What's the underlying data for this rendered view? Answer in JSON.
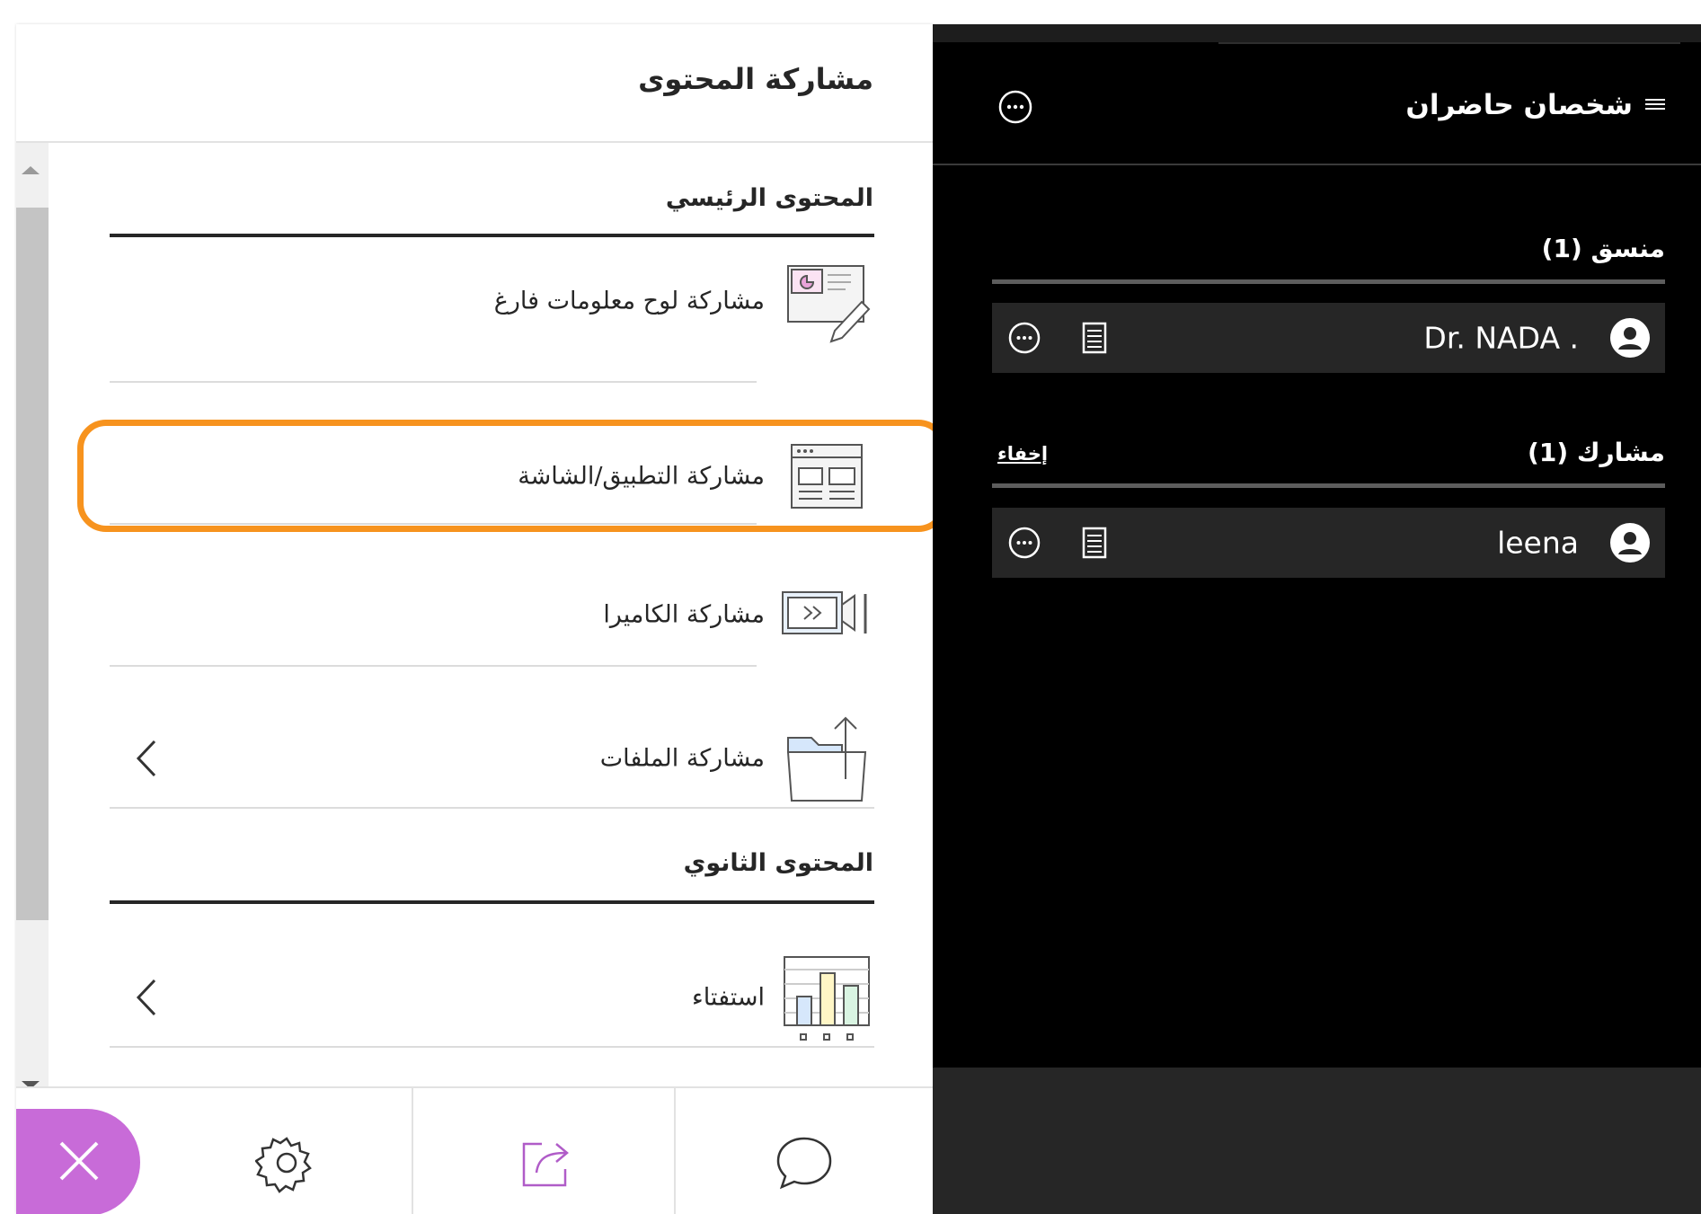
{
  "share_panel": {
    "title": "مشاركة المحتوى",
    "primary_heading": "المحتوى الرئيسي",
    "secondary_heading": "المحتوى الثانوي",
    "items": [
      {
        "label": "مشاركة لوح معلومات فارغ",
        "icon": "whiteboard-icon"
      },
      {
        "label": "مشاركة التطبيق/الشاشة",
        "icon": "screen-share-icon",
        "highlighted": true
      },
      {
        "label": "مشاركة الكاميرا",
        "icon": "camera-icon"
      },
      {
        "label": "مشاركة الملفات",
        "icon": "file-upload-icon",
        "has_submenu": true
      }
    ],
    "secondary_items": [
      {
        "label": "استفتاء",
        "icon": "poll-icon",
        "has_submenu": true
      }
    ]
  },
  "bottom_bar": {
    "buttons": [
      "close-icon",
      "gear-icon",
      "share-content-icon",
      "chat-icon"
    ],
    "accent_color": "#c86bd8"
  },
  "attendees": {
    "title": "شخصان حاضران",
    "groups": [
      {
        "heading": "منسق (1)",
        "people": [
          {
            "name": "Dr. NADA ."
          }
        ]
      },
      {
        "heading": "مشارك (1)",
        "action": "إخفاء",
        "people": [
          {
            "name": "leena"
          }
        ]
      }
    ]
  },
  "highlight_color": "#f7931e"
}
